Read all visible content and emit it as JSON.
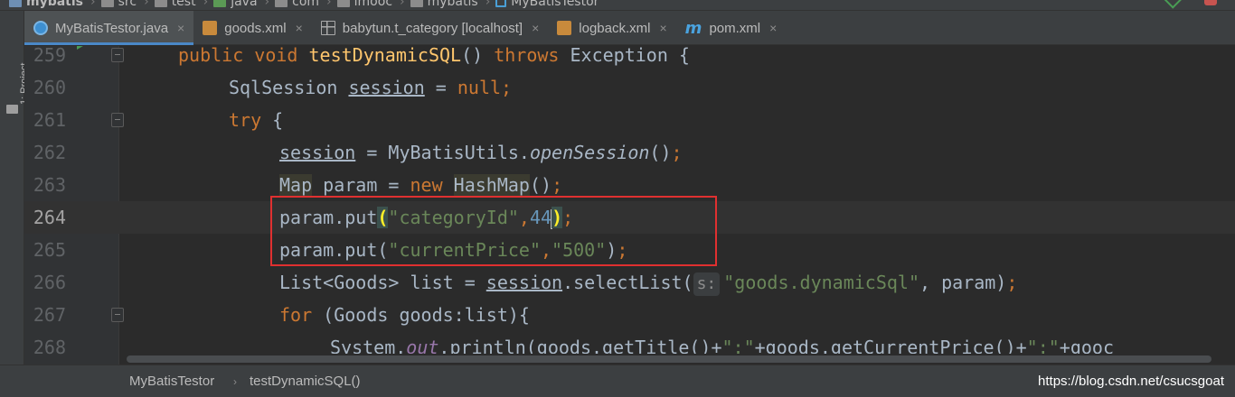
{
  "breadcrumb_top": {
    "items": [
      {
        "label": "mybatis",
        "icon": "module-icon"
      },
      {
        "label": "src",
        "icon": "folder-icon"
      },
      {
        "label": "test",
        "icon": "folder-icon"
      },
      {
        "label": "java",
        "icon": "source-folder-icon"
      },
      {
        "label": "com",
        "icon": "folder-icon"
      },
      {
        "label": "imooc",
        "icon": "folder-icon"
      },
      {
        "label": "mybatis",
        "icon": "folder-icon"
      },
      {
        "label": "MyBatisTestor",
        "icon": "class-icon"
      }
    ]
  },
  "tool_window": {
    "project_label": "1: Project"
  },
  "tabs": [
    {
      "label": "MyBatisTestor.java",
      "icon": "java-class-icon",
      "active": true
    },
    {
      "label": "goods.xml",
      "icon": "xml-file-icon",
      "active": false
    },
    {
      "label": "babytun.t_category [localhost]",
      "icon": "table-icon",
      "active": false
    },
    {
      "label": "logback.xml",
      "icon": "xml-file-icon",
      "active": false
    },
    {
      "label": "pom.xml",
      "icon": "maven-icon",
      "active": false
    }
  ],
  "tab_close_glyph": "×",
  "editor": {
    "line_numbers": [
      "259",
      "260",
      "261",
      "262",
      "263",
      "264",
      "265",
      "266",
      "267",
      "268"
    ],
    "current_line": "264",
    "parameter_hint": "s:",
    "code": {
      "l259": {
        "kw1": "public",
        "kw2": "void",
        "fn": "testDynamicSQL",
        "p1": "() ",
        "kw3": "throws",
        "rest": " Exception {"
      },
      "l260": {
        "type": "SqlSession ",
        "var": "session",
        "mid": " = ",
        "kw": "null",
        "semi": ";"
      },
      "l261": {
        "kw": "try",
        "rest": " {"
      },
      "l262": {
        "var": "session",
        "mid": " = MyBatisUtils.",
        "method": "openSession",
        "rest": "()",
        "semi": ";"
      },
      "l263": {
        "type": "Map",
        "mid": " param = ",
        "kw": "new",
        "sp": " ",
        "type2": "HashMap",
        "rest": "()",
        "semi": ";"
      },
      "l264": {
        "pre": "param.put",
        "paren_open": "(",
        "str": "\"categoryId\"",
        "comma": ",",
        "num": "44",
        "paren_close": ")",
        "semi": ";"
      },
      "l265": {
        "pre": "param.put(",
        "str1": "\"currentPrice\"",
        "comma": ",",
        "str2": "\"500\"",
        "rest": ")",
        "semi": ";"
      },
      "l266": {
        "pre": "List<Goods> list = ",
        "var": "session",
        "mid": ".selectList(",
        "str": "\"goods.dynamicSql\"",
        "rest": ", param)",
        "semi": ";"
      },
      "l267": {
        "kw": "for",
        "rest": " (Goods goods:list){"
      },
      "l268": {
        "pre": "System.",
        "field": "out",
        "mid": ".println(goods.getTitle()+",
        "str1": "\":\"",
        "mid2": "+goods.getCurrentPrice()+",
        "str2": "\":\"",
        "rest": "+gooc"
      }
    }
  },
  "bottom_breadcrumb": {
    "class_name": "MyBatisTestor",
    "separator": "›",
    "method_name": "testDynamicSQL()"
  },
  "watermark": "https://blog.csdn.net/csucsgoat",
  "colors": {
    "keyword": "#cc7832",
    "string": "#6a8759",
    "number": "#6897bb",
    "method": "#ffc66d",
    "annotation_box": "#e03030",
    "tab_active_underline": "#4a88c7"
  }
}
